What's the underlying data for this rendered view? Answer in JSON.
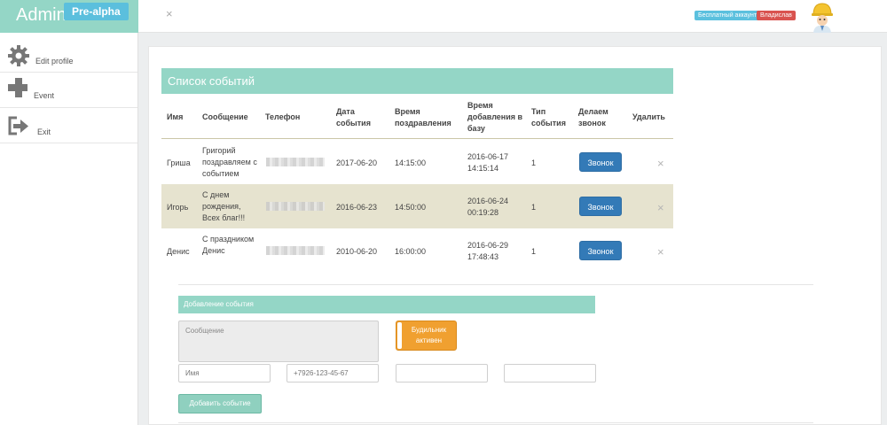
{
  "header": {
    "brand": "Admin",
    "brand_badge": "Pre-alpha",
    "collapse_icon": "×",
    "account_badge": "Бесплатный аккаунт",
    "owner_badge": "Владислав"
  },
  "sidebar": {
    "items": [
      {
        "label": "Edit profile",
        "icon": "gear-icon"
      },
      {
        "label": "Event",
        "icon": "plus-icon"
      },
      {
        "label": "Exit",
        "icon": "exit-icon"
      }
    ]
  },
  "events": {
    "title": "Список событий",
    "columns": {
      "name": "Имя",
      "message": "Сообщение",
      "phone": "Телефон",
      "event_date": "Дата события",
      "greet_time": "Время поздравления",
      "added_time": "Время добавления в базу",
      "event_type": "Тип события",
      "call": "Делаем звонок",
      "delete": "Удалить"
    },
    "rows": [
      {
        "name": "Гриша",
        "message": "Григорий поздравляем с событием",
        "event_date": "2017-06-20",
        "greet_time": "14:15:00",
        "added_time": "2016-06-17 14:15:14",
        "event_type": "1",
        "call_label": "Звонок",
        "delete_icon": "×"
      },
      {
        "name": "Игорь",
        "message": "С днем рождения, Всех благ!!!",
        "event_date": "2016-06-23",
        "greet_time": "14:50:00",
        "added_time": "2016-06-24 00:19:28",
        "event_type": "1",
        "call_label": "Звонок",
        "delete_icon": "×"
      },
      {
        "name": "Денис",
        "message": "С праздником Денис",
        "event_date": "2010-06-20",
        "greet_time": "16:00:00",
        "added_time": "2016-06-29 17:48:43",
        "event_type": "1",
        "call_label": "Звонок",
        "delete_icon": "×"
      }
    ]
  },
  "add_form": {
    "title": "Добавление события",
    "message_placeholder": "Сообщение",
    "alarm_label": "Будильник активен",
    "name_placeholder": "Имя",
    "phone_placeholder": "+7926-123-45-67",
    "field3_value": "",
    "field4_value": "",
    "submit_label": "Добавить событие"
  },
  "colors": {
    "accent": "#94d6c6",
    "primary_button": "#337ab7",
    "alarm": "#f0a030",
    "row_alt": "#e6e3cf"
  }
}
